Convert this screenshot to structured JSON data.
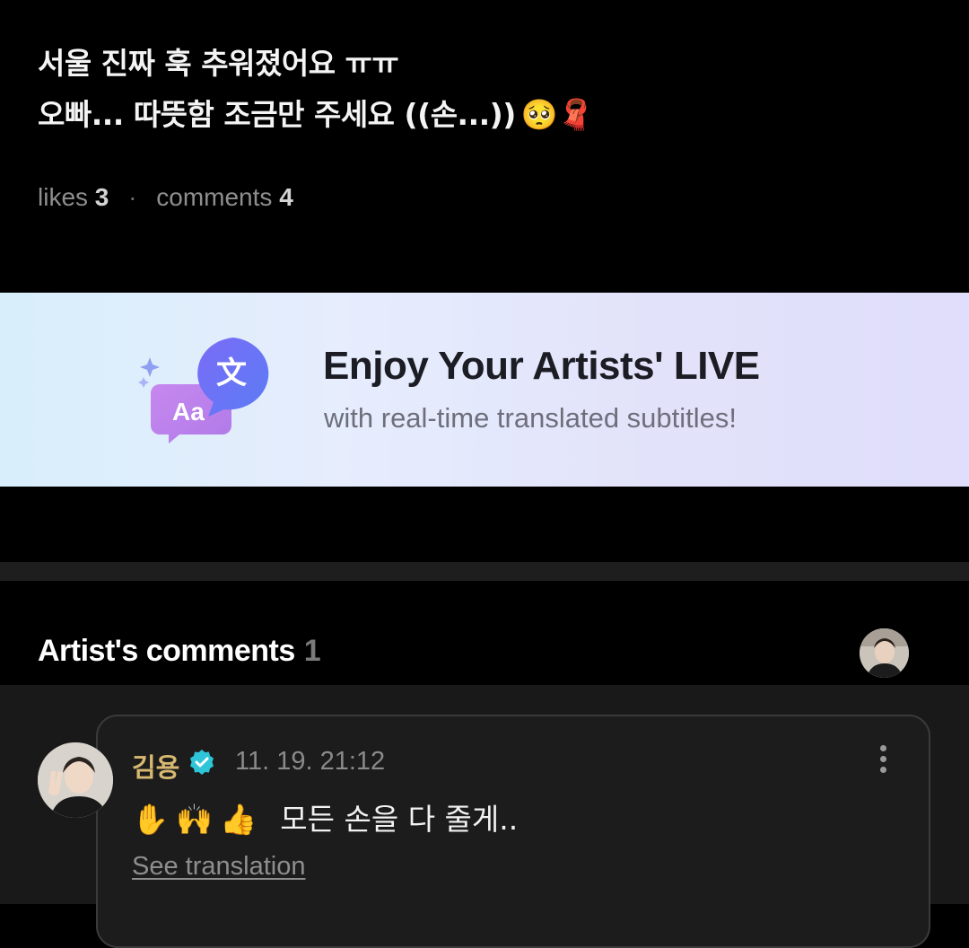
{
  "post": {
    "line1": "서울 진짜 훅 추워졌어요 ㅠㅠ",
    "line2": "오빠... 따뜻함 조금만 주세요 ((손...))",
    "line2_emoji": "🥺🧣",
    "likes_label": "likes",
    "likes_count": "3",
    "comments_label": "comments",
    "comments_count": "4",
    "separator": "·"
  },
  "banner": {
    "title": "Enjoy Your Artists' LIVE",
    "subtitle": "with real-time translated subtitles!",
    "icon": "translate-bubbles-icon",
    "icon_glyph_front": "Aa",
    "icon_glyph_back": "文"
  },
  "artist_comments": {
    "title": "Artist's comments",
    "count": "1"
  },
  "comments": [
    {
      "author": "김용",
      "verified": true,
      "timestamp": "11. 19. 21:12",
      "emojis": "✋🙌👍",
      "text": "모든 손을 다 줄게..",
      "translation_link": "See translation"
    }
  ],
  "colors": {
    "background": "#000000",
    "author_gold": "#d6b871",
    "verified_badge": "#2ec5d8",
    "banner_accent": "#8b5cf6"
  }
}
